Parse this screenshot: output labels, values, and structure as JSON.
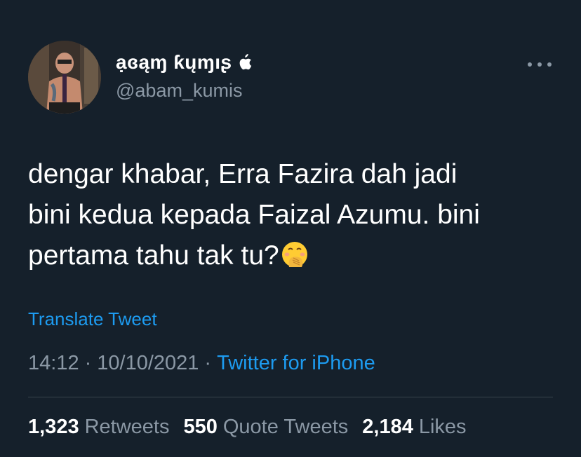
{
  "user": {
    "display_name": "ạɞąɱ ƙųɱıʂ",
    "handle": "@abam_kumis",
    "badge_icon": "apple-icon"
  },
  "tweet": {
    "lines": [
      "dengar khabar, Erra Fazira dah jadi",
      "bini kedua kepada Faizal Azumu. bini",
      "pertama tahu tak tu?"
    ],
    "emoji": "face-with-hand-over-mouth-emoji"
  },
  "translate_label": "Translate Tweet",
  "meta": {
    "time": "14:12",
    "date": "10/10/2021",
    "separator": "·",
    "source": "Twitter for iPhone"
  },
  "stats": {
    "retweets": {
      "count": "1,323",
      "label": "Retweets"
    },
    "quotes": {
      "count": "550",
      "label": "Quote Tweets"
    },
    "likes": {
      "count": "2,184",
      "label": "Likes"
    }
  },
  "colors": {
    "background": "#15202b",
    "text": "#ffffff",
    "secondary": "#8b98a5",
    "link": "#1d9bf0",
    "divider": "#38444d"
  }
}
